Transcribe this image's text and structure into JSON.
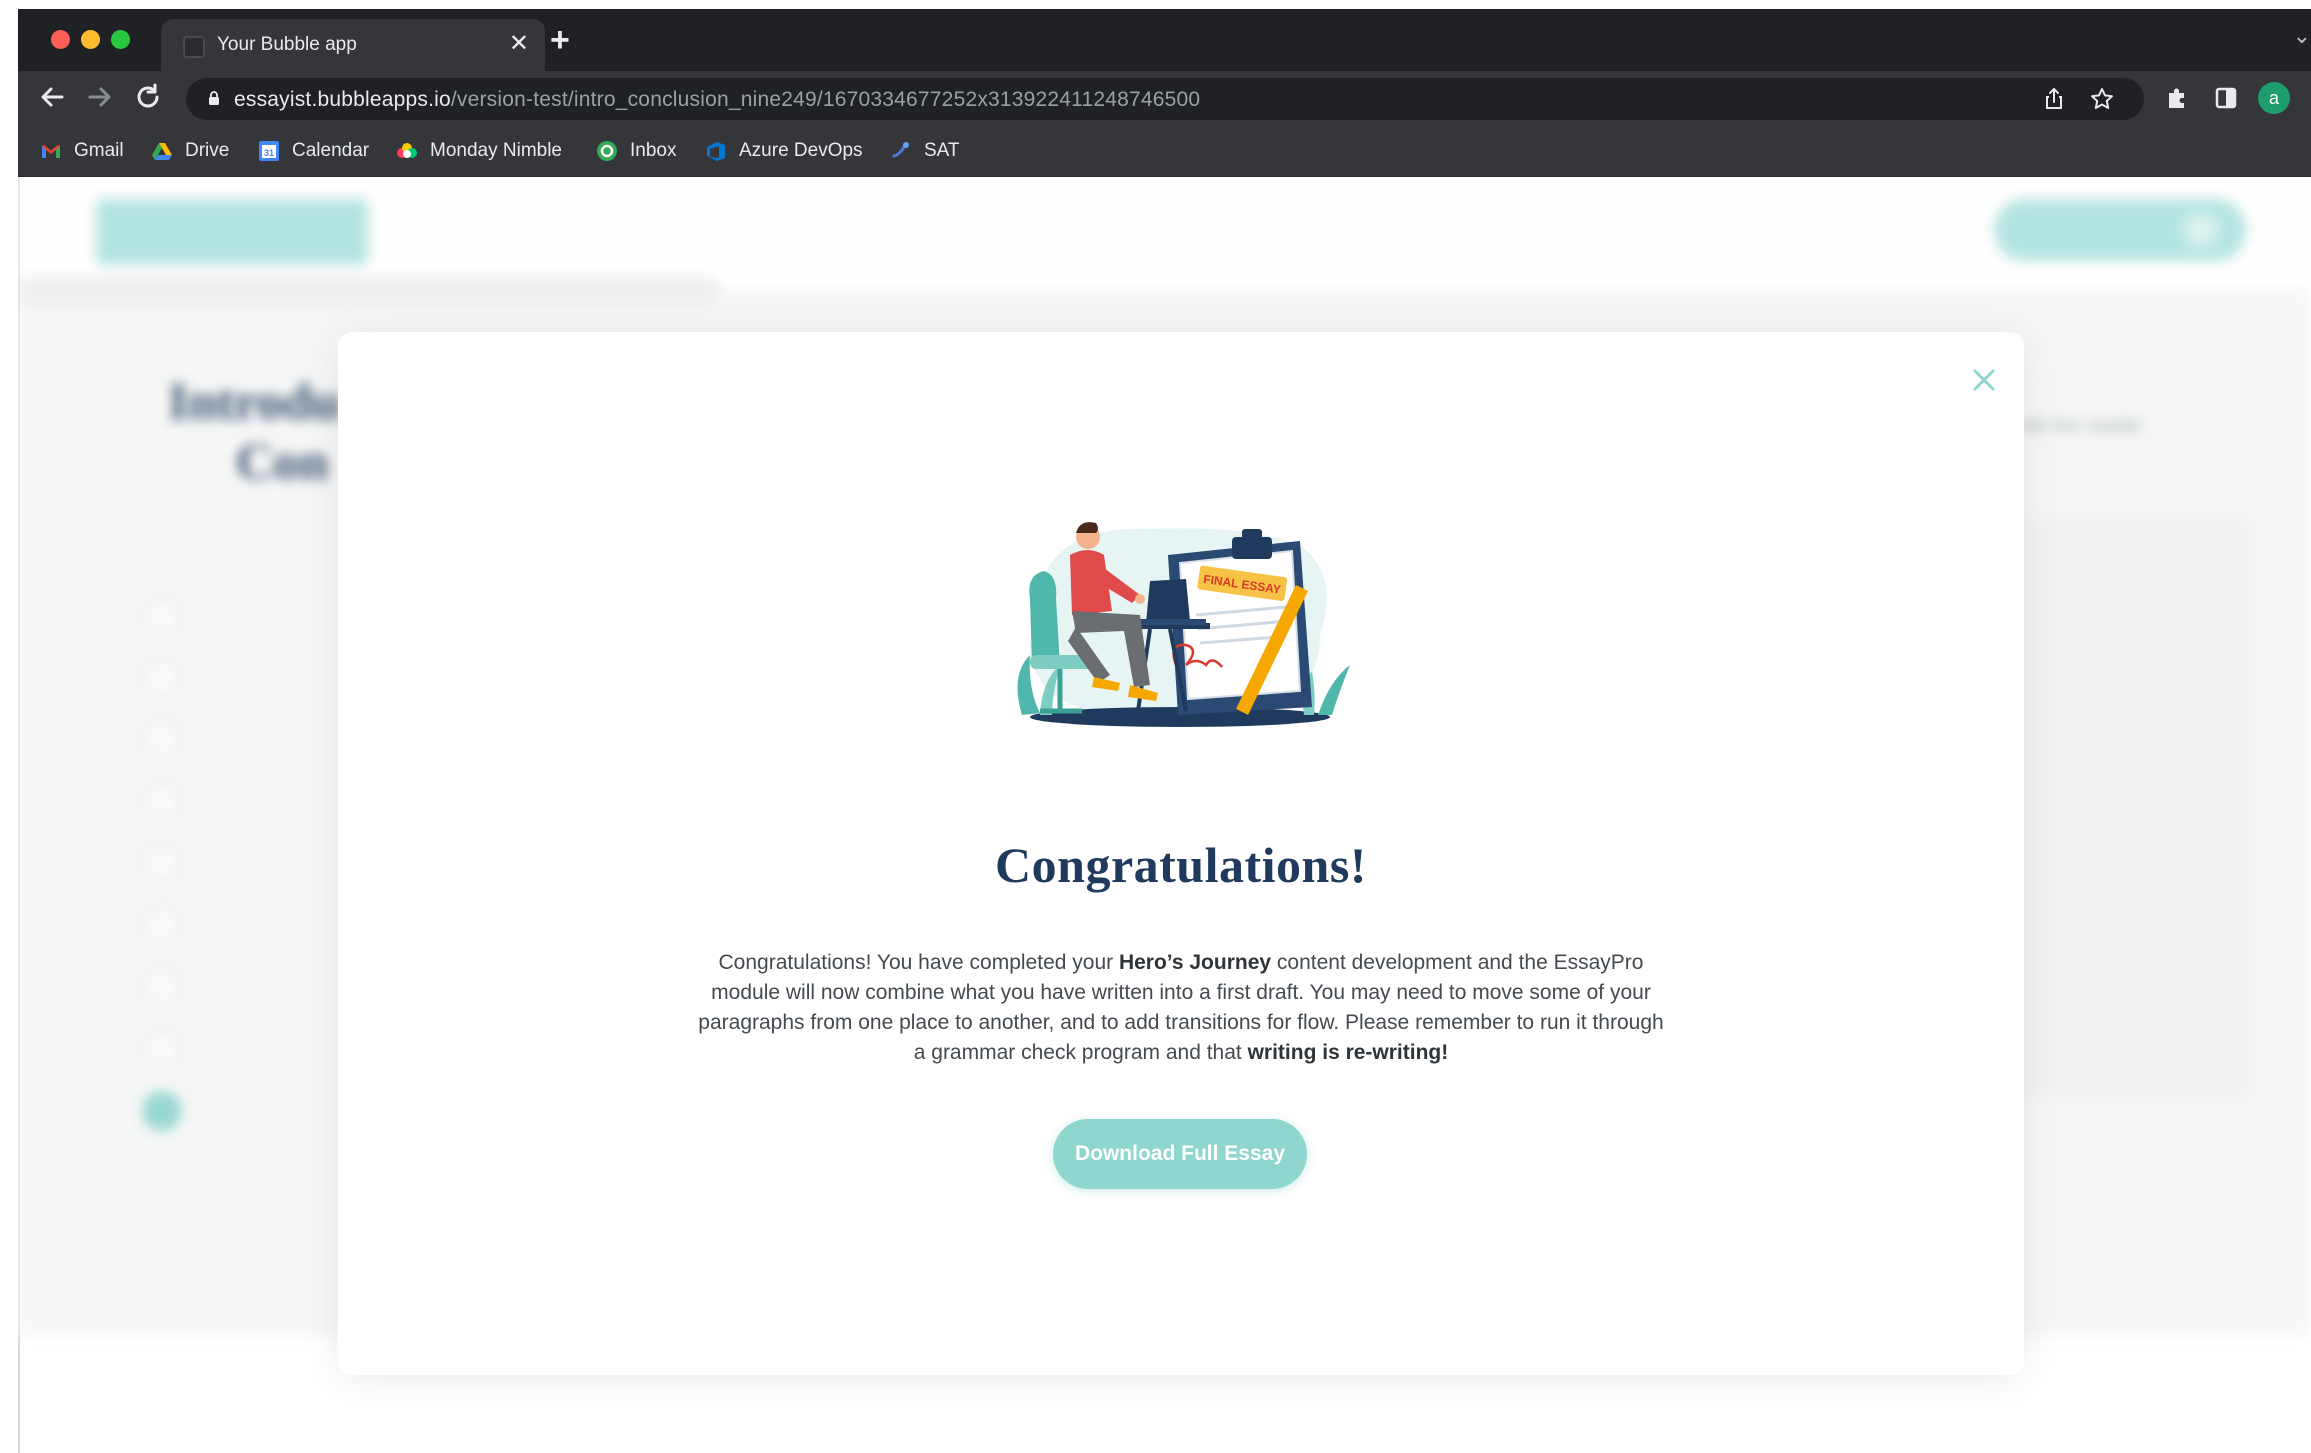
{
  "browser": {
    "tab_title": "Your Bubble app",
    "tab_close_glyph": "✕",
    "new_tab_glyph": "+",
    "url_host": "essayist.bubbleapps.io",
    "url_path": "/version-test/intro_conclusion_nine249/1670334677252x313922411248746500",
    "profile_initial": "a",
    "bookmarks": [
      {
        "label": "Gmail",
        "icon": "gmail-icon"
      },
      {
        "label": "Drive",
        "icon": "drive-icon"
      },
      {
        "label": "Calendar",
        "icon": "calendar-icon"
      },
      {
        "label": "Monday Nimble",
        "icon": "monday-icon"
      },
      {
        "label": "Inbox",
        "icon": "inbox-icon"
      },
      {
        "label": "Azure DevOps",
        "icon": "azure-devops-icon"
      },
      {
        "label": "SAT",
        "icon": "sat-icon"
      }
    ]
  },
  "background": {
    "title_line1": "Introdu",
    "title_line2": "Con",
    "right_text": "rab the reader"
  },
  "modal": {
    "close_icon": "close-icon",
    "title": "Congratulations!",
    "illustration_label": "FINAL ESSAY",
    "body_part1": "Congratulations! You have completed your ",
    "body_bold1": "Hero’s Journey",
    "body_part2": " content development and the EssayPro module will now combine what you have written into a first draft. You may need to move some of your paragraphs from one place to another, and to add transitions for flow. Please remember to run it through a grammar check program and that ",
    "body_bold2": "writing is re-writing!",
    "download_button": "Download Full Essay",
    "accent_color": "#8ed6ce",
    "title_color": "#1f3a5c"
  }
}
